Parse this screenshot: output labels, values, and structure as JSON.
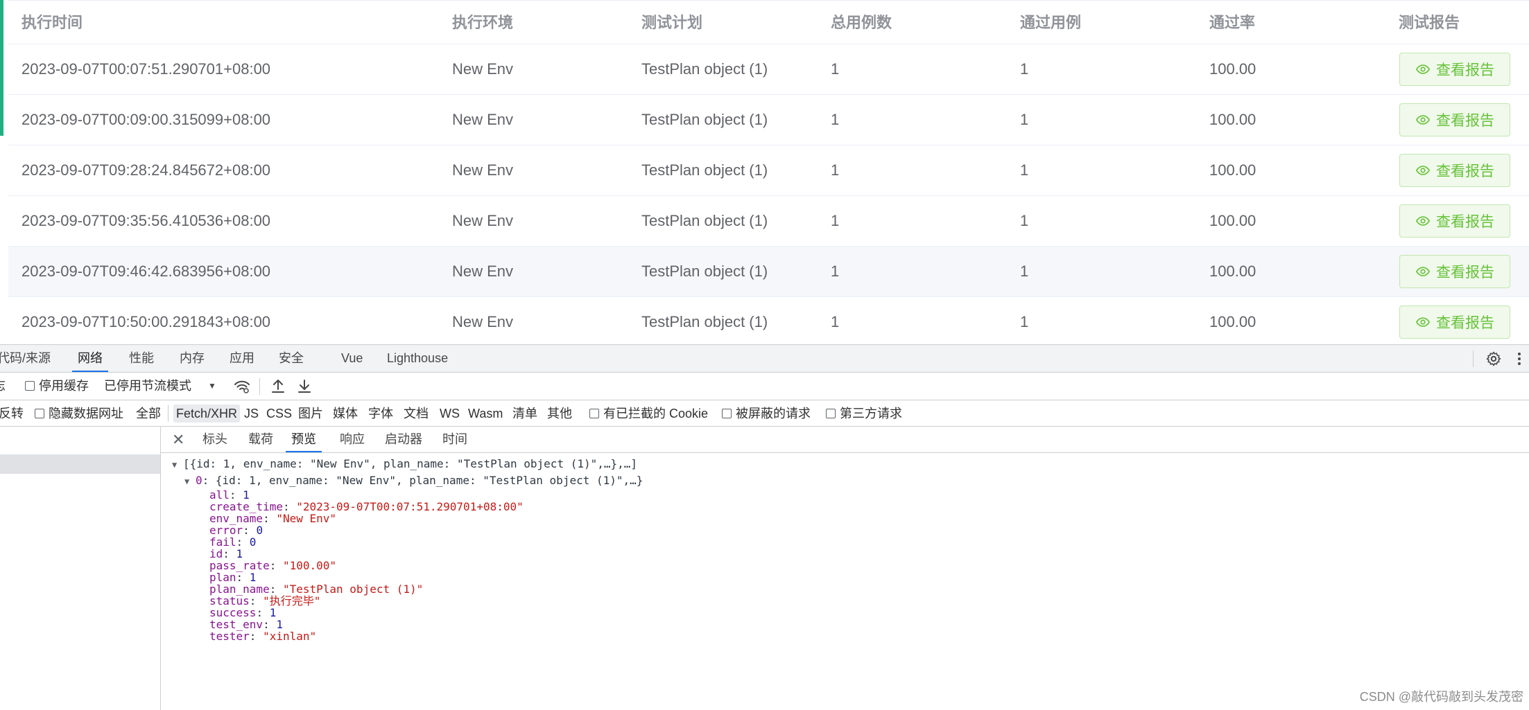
{
  "table": {
    "headers": [
      "执行时间",
      "执行环境",
      "测试计划",
      "总用例数",
      "通过用例",
      "通过率",
      "测试报告"
    ],
    "button_label": "查看报告",
    "rows": [
      {
        "time": "2023-09-07T00:07:51.290701+08:00",
        "env": "New Env",
        "plan": "TestPlan object (1)",
        "total": "1",
        "passed": "1",
        "rate": "100.00"
      },
      {
        "time": "2023-09-07T00:09:00.315099+08:00",
        "env": "New Env",
        "plan": "TestPlan object (1)",
        "total": "1",
        "passed": "1",
        "rate": "100.00"
      },
      {
        "time": "2023-09-07T09:28:24.845672+08:00",
        "env": "New Env",
        "plan": "TestPlan object (1)",
        "total": "1",
        "passed": "1",
        "rate": "100.00"
      },
      {
        "time": "2023-09-07T09:35:56.410536+08:00",
        "env": "New Env",
        "plan": "TestPlan object (1)",
        "total": "1",
        "passed": "1",
        "rate": "100.00"
      },
      {
        "time": "2023-09-07T09:46:42.683956+08:00",
        "env": "New Env",
        "plan": "TestPlan object (1)",
        "total": "1",
        "passed": "1",
        "rate": "100.00"
      },
      {
        "time": "2023-09-07T10:50:00.291843+08:00",
        "env": "New Env",
        "plan": "TestPlan object (1)",
        "total": "1",
        "passed": "1",
        "rate": "100.00"
      }
    ],
    "colors": {
      "accent": "#1fb07f",
      "button_text": "#67c23a",
      "button_bg": "#f0f9eb",
      "button_border": "#c2e7b0"
    }
  },
  "devtools": {
    "tabs": [
      "代码/来源",
      "网络",
      "性能",
      "内存",
      "应用",
      "安全",
      "Vue",
      "Lighthouse"
    ],
    "active_tab": "网络",
    "toolbar": {
      "cut_label": "志",
      "disable_cache": "停用缓存",
      "throttle": "已停用节流模式"
    },
    "filter": {
      "invert": "反转",
      "hide_data_urls": "隐藏数据网址",
      "types": [
        "全部",
        "Fetch/XHR",
        "JS",
        "CSS",
        "图片",
        "媒体",
        "字体",
        "文档",
        "WS",
        "Wasm",
        "清单",
        "其他"
      ],
      "active_type": "Fetch/XHR",
      "blocked_cookies": "有已拦截的 Cookie",
      "blocked_requests": "被屏蔽的请求",
      "third_party": "第三方请求"
    },
    "detail_tabs": [
      "标头",
      "载荷",
      "预览",
      "响应",
      "启动器",
      "时间"
    ],
    "active_detail_tab": "预览",
    "preview": {
      "summary_line": "[{id: 1, env_name: \"New Env\", plan_name: \"TestPlan object (1)\",…},…]",
      "item_line_index": "0",
      "item_line_rest": "{id: 1, env_name: \"New Env\", plan_name: \"TestPlan object (1)\",…}",
      "fields": [
        {
          "key": "all",
          "value": "1",
          "kind": "n"
        },
        {
          "key": "create_time",
          "value": "\"2023-09-07T00:07:51.290701+08:00\"",
          "kind": "s"
        },
        {
          "key": "env_name",
          "value": "\"New Env\"",
          "kind": "s"
        },
        {
          "key": "error",
          "value": "0",
          "kind": "n"
        },
        {
          "key": "fail",
          "value": "0",
          "kind": "n"
        },
        {
          "key": "id",
          "value": "1",
          "kind": "n"
        },
        {
          "key": "pass_rate",
          "value": "\"100.00\"",
          "kind": "s"
        },
        {
          "key": "plan",
          "value": "1",
          "kind": "n"
        },
        {
          "key": "plan_name",
          "value": "\"TestPlan object (1)\"",
          "kind": "s"
        },
        {
          "key": "status",
          "value": "\"执行完毕\"",
          "kind": "s"
        },
        {
          "key": "success",
          "value": "1",
          "kind": "n"
        },
        {
          "key": "test_env",
          "value": "1",
          "kind": "n"
        },
        {
          "key": "tester",
          "value": "\"xinlan\"",
          "kind": "s"
        }
      ]
    }
  },
  "watermark": "CSDN @敲代码敲到头发茂密"
}
